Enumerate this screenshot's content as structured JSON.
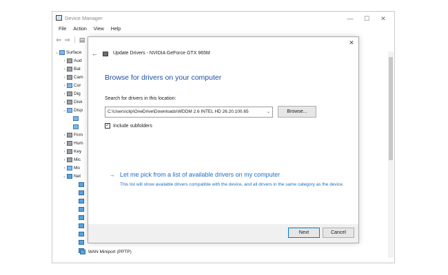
{
  "window": {
    "title": "Device Manager",
    "controls": [
      "—",
      "☐",
      "✕"
    ]
  },
  "menu": [
    "File",
    "Action",
    "View",
    "Help"
  ],
  "tree": {
    "root": "Surface",
    "items": [
      {
        "label": "Aud",
        "expanded": false
      },
      {
        "label": "Bat",
        "expanded": false
      },
      {
        "label": "Cam",
        "expanded": false
      },
      {
        "label": "Cor",
        "expanded": false
      },
      {
        "label": "Dig",
        "expanded": false
      },
      {
        "label": "Disk",
        "expanded": false
      },
      {
        "label": "Disp",
        "expanded": true
      },
      {
        "label": "Firm",
        "expanded": false
      },
      {
        "label": "Hum",
        "expanded": false
      },
      {
        "label": "Key",
        "expanded": false
      },
      {
        "label": "Mic",
        "expanded": false
      },
      {
        "label": "Mo",
        "expanded": false
      },
      {
        "label": "Net",
        "expanded": true
      }
    ],
    "bottom_items": [
      "WAN Miniport (PPTP)"
    ]
  },
  "dialog": {
    "close": "✕",
    "back": "←",
    "title": "Update Drivers - NVIDIA GeForce GTX 965M",
    "heading": "Browse for drivers on your computer",
    "search_label": "Search for drivers in this location:",
    "path_value": "C:\\Users\\clip\\OneDrive\\Downloads\\WDDM 2.6 INTEL HD 26.20.100.65",
    "combo_arrow": "⌄",
    "browse_label": "Browse...",
    "include_subfolders": {
      "label": "Include subfolders",
      "checked": true,
      "mark": "✓"
    },
    "pick": {
      "arrow": "→",
      "label": "Let me pick from a list of available drivers on my computer",
      "description": "This list will show available drivers compatible with the device, and all drivers in the same category as the device."
    },
    "next_label": "Next",
    "cancel_label": "Cancel"
  },
  "colors": {
    "accent": "#0078d7",
    "link": "#1a6fc4",
    "heading": "#1a4fa0",
    "footer_bg": "#f0f0f0"
  }
}
